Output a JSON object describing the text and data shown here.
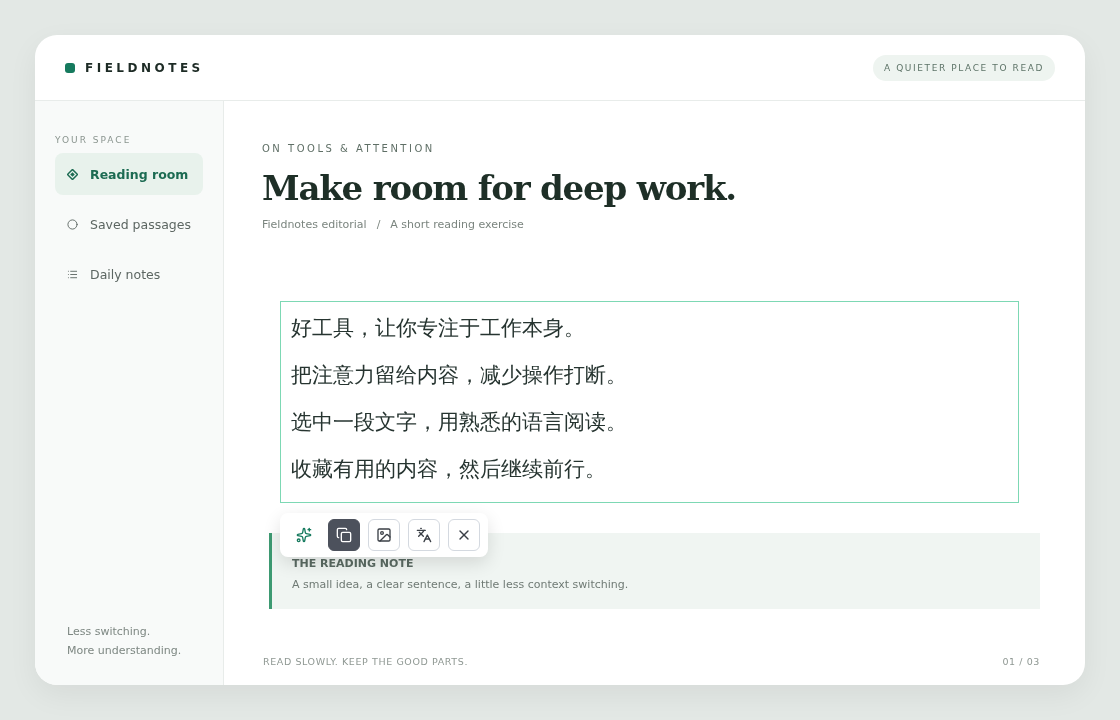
{
  "brand": {
    "name": "FIELDNOTES"
  },
  "tagline": "A QUIETER PLACE TO READ",
  "sidebar": {
    "heading": "YOUR SPACE",
    "items": [
      {
        "label": "Reading room",
        "kind": "diamond",
        "selected": true
      },
      {
        "label": "Saved passages",
        "kind": "circle",
        "selected": false
      },
      {
        "label": "Daily notes",
        "kind": "list",
        "selected": false
      }
    ],
    "footer": [
      "Less switching.",
      "More understanding."
    ]
  },
  "article": {
    "eyebrow": "ON TOOLS & ATTENTION",
    "title": "Make room for deep work.",
    "byline": [
      "Fieldnotes editorial",
      "/",
      "A short reading exercise"
    ],
    "passage": [
      "好工具，让你专注于工作本身。",
      "把注意力留给内容，减少操作打断。",
      "选中一段文字，用熟悉的语言阅读。",
      "收藏有用的内容，然后继续前行。"
    ],
    "toolbar": [
      {
        "kind": "sparkle",
        "selected": false
      },
      {
        "kind": "copy",
        "selected": true
      },
      {
        "kind": "image",
        "selected": false
      },
      {
        "kind": "translate",
        "selected": false
      },
      {
        "kind": "close",
        "selected": false
      }
    ],
    "note": {
      "heading": "THE READING NOTE",
      "body": "A small idea, a clear sentence, a little less context switching."
    }
  },
  "footer": {
    "motto": "READ SLOWLY. KEEP THE GOOD PARTS.",
    "page": "01 / 03"
  }
}
